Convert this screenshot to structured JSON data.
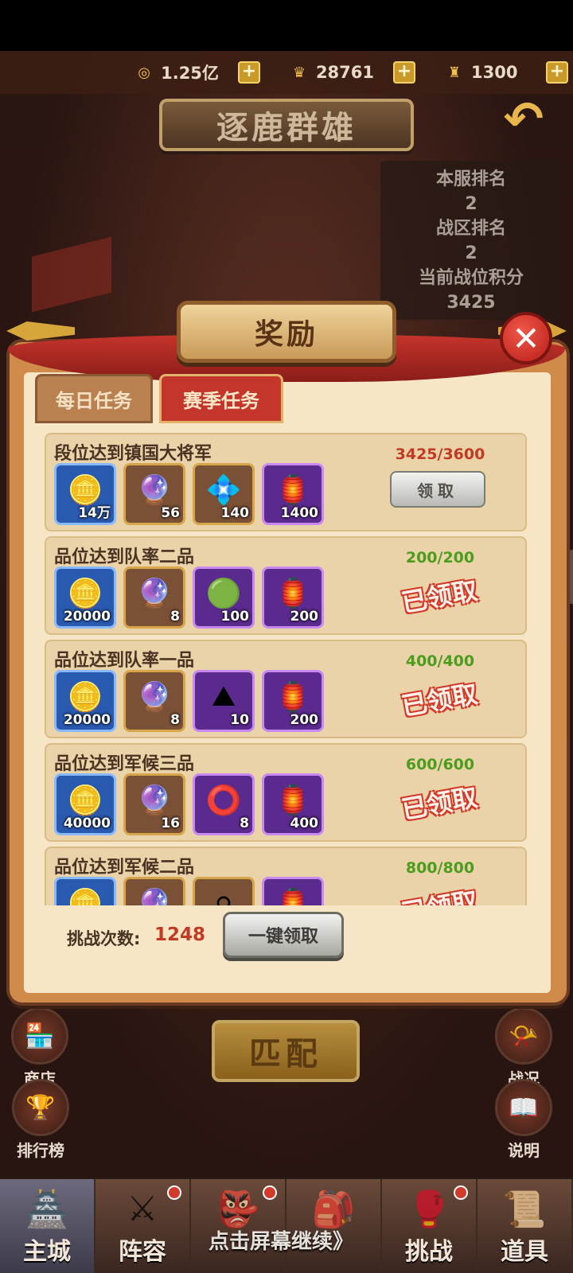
{
  "currencies": [
    {
      "icon": "coin-icon",
      "glyph": "◎",
      "value": "1.25亿"
    },
    {
      "icon": "gold-ingot-icon",
      "glyph": "♛",
      "value": "28761"
    },
    {
      "icon": "token-icon",
      "glyph": "♜",
      "value": "1300"
    }
  ],
  "plus_label": "+",
  "page_title": "逐鹿群雄",
  "back_glyph": "↶",
  "rank_panel": {
    "server_rank_label": "本服排名",
    "server_rank": "2",
    "zone_rank_label": "战区排名",
    "zone_rank": "2",
    "points_label": "当前战位积分",
    "points": "3425"
  },
  "dialog": {
    "title": "奖励",
    "close_glyph": "✕",
    "tabs": [
      "每日任务",
      "赛季任务"
    ],
    "tasks": [
      {
        "title": "段位达到镇国大将军",
        "progress": "3425/3600",
        "status": "claim",
        "button": "领取",
        "items": [
          {
            "frame": "blue",
            "glyph": "🪙",
            "icon": "coin-icon",
            "qty": "14万"
          },
          {
            "frame": "brown",
            "glyph": "🔮",
            "icon": "orb-chest-icon",
            "qty": "56"
          },
          {
            "frame": "brown",
            "glyph": "💠",
            "icon": "crystal-ore-icon",
            "qty": "140"
          },
          {
            "frame": "purple",
            "glyph": "🏮",
            "icon": "purple-lantern-icon",
            "qty": "1400"
          }
        ]
      },
      {
        "title": "品位达到队率二品",
        "progress": "200/200",
        "status": "claimed",
        "stamp": "已领取",
        "items": [
          {
            "frame": "blue",
            "glyph": "🪙",
            "icon": "coin-icon",
            "qty": "20000"
          },
          {
            "frame": "brown",
            "glyph": "🔮",
            "icon": "orb-chest-icon",
            "qty": "8"
          },
          {
            "frame": "purple",
            "glyph": "🟢",
            "icon": "jade-scroll-icon",
            "qty": "100"
          },
          {
            "frame": "purple",
            "glyph": "🏮",
            "icon": "purple-lantern-icon",
            "qty": "200"
          }
        ]
      },
      {
        "title": "品位达到队率一品",
        "progress": "400/400",
        "status": "claimed",
        "stamp": "已领取",
        "items": [
          {
            "frame": "blue",
            "glyph": "🪙",
            "icon": "coin-icon",
            "qty": "20000"
          },
          {
            "frame": "brown",
            "glyph": "🔮",
            "icon": "orb-chest-icon",
            "qty": "8"
          },
          {
            "frame": "purple",
            "glyph": "⛰",
            "icon": "purple-crystal-icon",
            "qty": "10"
          },
          {
            "frame": "purple",
            "glyph": "🏮",
            "icon": "purple-lantern-icon",
            "qty": "200"
          }
        ]
      },
      {
        "title": "品位达到军候三品",
        "progress": "600/600",
        "status": "claimed",
        "stamp": "已领取",
        "items": [
          {
            "frame": "blue",
            "glyph": "🪙",
            "icon": "coin-icon",
            "qty": "40000"
          },
          {
            "frame": "brown",
            "glyph": "🔮",
            "icon": "orb-chest-icon",
            "qty": "16"
          },
          {
            "frame": "purple",
            "glyph": "⭕",
            "icon": "purple-ring-icon",
            "qty": "8"
          },
          {
            "frame": "purple",
            "glyph": "🏮",
            "icon": "purple-lantern-icon",
            "qty": "400"
          }
        ]
      },
      {
        "title": "品位达到军候二品",
        "progress": "800/800",
        "status": "claimed",
        "stamp": "已领取",
        "items": [
          {
            "frame": "blue",
            "glyph": "🪙",
            "icon": "coin-icon",
            "qty": ""
          },
          {
            "frame": "brown",
            "glyph": "🔮",
            "icon": "orb-chest-icon",
            "qty": ""
          },
          {
            "frame": "brown",
            "glyph": "⚪",
            "icon": "pearl-icon",
            "qty": ""
          },
          {
            "frame": "purple",
            "glyph": "🏮",
            "icon": "purple-lantern-icon",
            "qty": ""
          }
        ]
      }
    ],
    "challenge_label": "挑战次数:",
    "challenge_count": "1248",
    "claim_all": "一键领取"
  },
  "match_button": "匹配",
  "side_buttons": {
    "shop": "商店",
    "ranking": "排行榜",
    "battle_report": "战况",
    "instructions": "说明"
  },
  "bottom_nav": [
    {
      "label": "主城",
      "icon": "castle-icon",
      "glyph": "🏯",
      "dot": false,
      "active": true
    },
    {
      "label": "阵容",
      "icon": "formation-icon",
      "glyph": "⚔",
      "dot": true,
      "active": false
    },
    {
      "label": "",
      "icon": "hero-icon",
      "glyph": "👺",
      "dot": true,
      "active": false
    },
    {
      "label": "",
      "icon": "bag-icon",
      "glyph": "🎒",
      "dot": false,
      "active": false
    },
    {
      "label": "挑战",
      "icon": "challenge-icon",
      "glyph": "🥊",
      "dot": true,
      "active": false
    },
    {
      "label": "道具",
      "icon": "items-icon",
      "glyph": "📜",
      "dot": false,
      "active": false
    }
  ],
  "continue_text": "点击屏幕继续》"
}
